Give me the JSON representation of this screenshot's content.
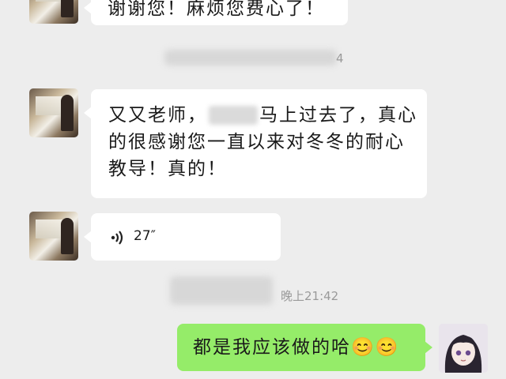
{
  "messages": [
    {
      "text": "谢谢您！麻烦您费心了！"
    },
    {
      "line1_before": "又又老师，",
      "line1_after": "马上过去了，真心",
      "line2": "的很感谢您一直以来对冬冬的耐心",
      "line3": "教导！真的！"
    },
    {
      "type": "voice",
      "duration": "27″",
      "icon": "voice-wave-icon"
    }
  ],
  "timestamps": {
    "first_partial": "4",
    "second": "晚上21:42"
  },
  "reply": {
    "text": "都是我应该做的哈",
    "emojis": [
      "😊",
      "😊"
    ]
  },
  "colors": {
    "background": "#ededed",
    "incoming_bubble": "#ffffff",
    "outgoing_bubble": "#95ec69",
    "timestamp": "#9a9a9a"
  }
}
